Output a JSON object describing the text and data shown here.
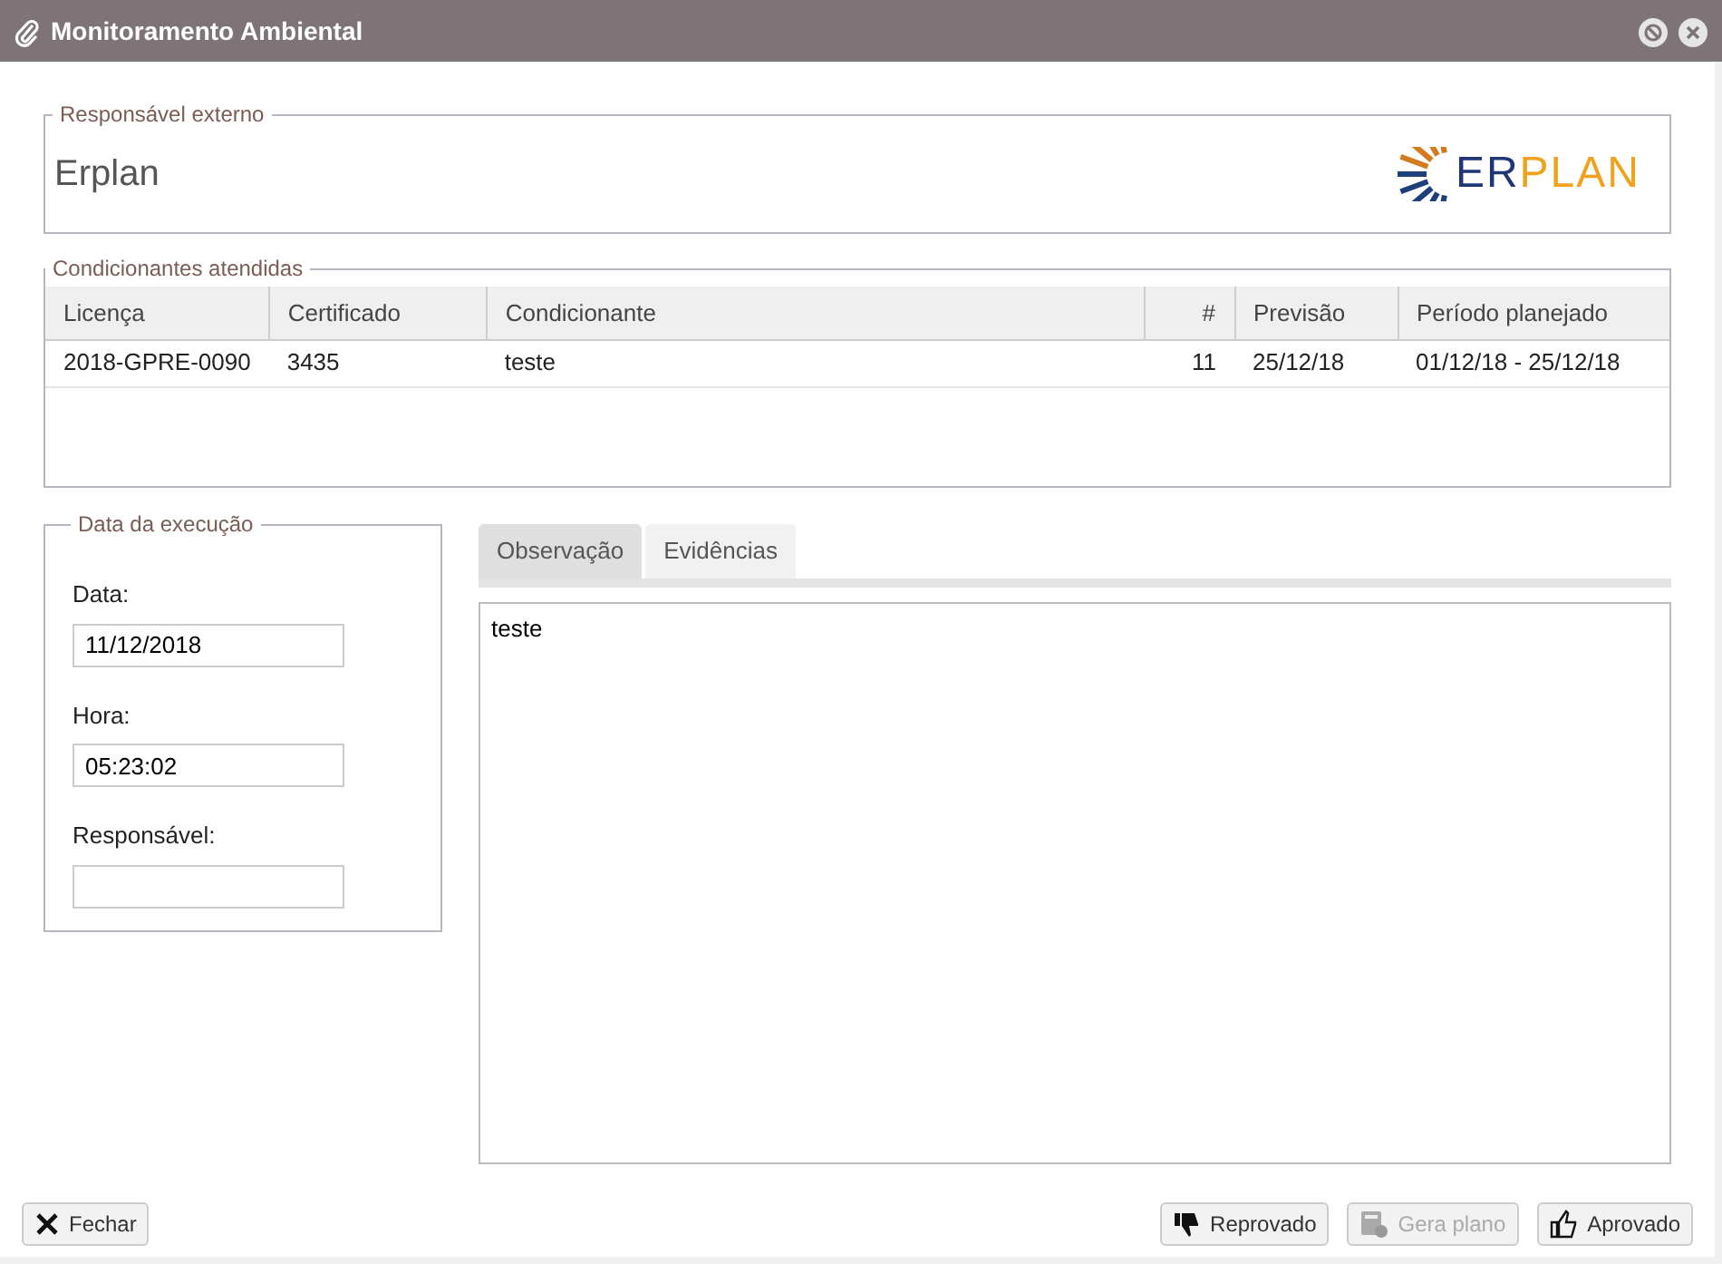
{
  "window": {
    "title": "Monitoramento Ambiental"
  },
  "external": {
    "legend": "Responsável externo",
    "name": "Erplan",
    "logo": [
      "ER",
      "PLAN"
    ]
  },
  "conditions": {
    "legend": "Condicionantes atendidas",
    "columns": [
      "Licença",
      "Certificado",
      "Condicionante",
      "#",
      "Previsão",
      "Período planejado"
    ],
    "rows": [
      [
        "2018-GPRE-0090",
        "3435",
        "teste",
        "11",
        "25/12/18",
        "01/12/18 - 25/12/18"
      ]
    ]
  },
  "execution": {
    "legend": "Data da execução",
    "fields": [
      {
        "label": "Data:",
        "value": "11/12/2018"
      },
      {
        "label": "Hora:",
        "value": "05:23:02"
      },
      {
        "label": "Responsável:"
      }
    ]
  },
  "tabs": [
    {
      "label": "Observação",
      "selected": true
    },
    {
      "label": "Evidências",
      "selected": false
    }
  ],
  "observation": {
    "value": "teste"
  },
  "buttons": [
    {
      "label": "Fechar",
      "kind": "close",
      "disabled": false
    },
    {
      "label": "Reprovado",
      "kind": "reject",
      "disabled": false
    },
    {
      "label": "Gera plano",
      "kind": "plan",
      "disabled": true
    },
    {
      "label": "Aprovado",
      "kind": "approve",
      "disabled": false
    }
  ]
}
